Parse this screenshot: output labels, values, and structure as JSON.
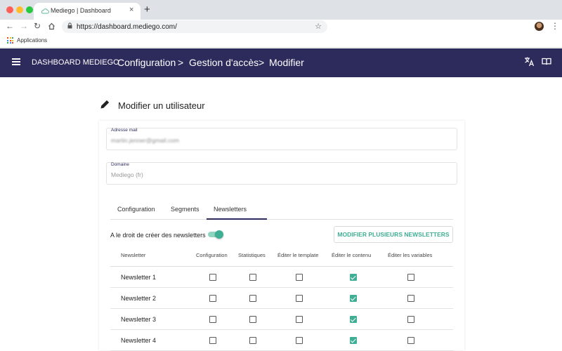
{
  "browser": {
    "tab_title": "Mediego | Dashboard",
    "tab_close_glyph": "×",
    "new_tab_glyph": "+",
    "url": "https://dashboard.mediego.com/",
    "bookmark_apps_label": "Applications",
    "traffic_colors": [
      "#ff5f57",
      "#ffbd2e",
      "#28c940"
    ]
  },
  "appbar": {
    "brand": "DASHBOARD MEDIEGO",
    "breadcrumbs": [
      "Configuration",
      ">",
      "Gestion d'accès",
      ">",
      "Modifier"
    ],
    "background": "#2d2b5c"
  },
  "page": {
    "title": "Modifier un utilisateur"
  },
  "form": {
    "email_label": "Adresse mail",
    "email_value": "martin.jenner@gmail.com",
    "domain_label": "Domaine",
    "domain_value": "Mediego (fr)"
  },
  "tabs": [
    {
      "label": "Configuration",
      "active": false
    },
    {
      "label": "Segments",
      "active": false
    },
    {
      "label": "Newsletters",
      "active": true
    }
  ],
  "newsletters": {
    "create_right_label": "A le droit de créer des newsletters",
    "create_right_enabled": true,
    "bulk_button": "MODIFIER PLUSIEURS NEWSLETTERS",
    "accent": "#3fae94",
    "columns": [
      "Newsletter",
      "Configuration",
      "Statistiques",
      "Éditer le template",
      "Éditer le contenu",
      "Éditer les variables"
    ],
    "rows": [
      {
        "name": "Newsletter 1",
        "checks": [
          false,
          false,
          false,
          true,
          false
        ]
      },
      {
        "name": "Newsletter 2",
        "checks": [
          false,
          false,
          false,
          true,
          false
        ]
      },
      {
        "name": "Newsletter 3",
        "checks": [
          false,
          false,
          false,
          true,
          false
        ]
      },
      {
        "name": "Newsletter 4",
        "checks": [
          false,
          false,
          false,
          true,
          false
        ]
      }
    ]
  },
  "icons": {
    "menu": "hamburger-icon",
    "translate": "translate-icon",
    "docs": "book-icon",
    "edit": "pencil-icon"
  }
}
